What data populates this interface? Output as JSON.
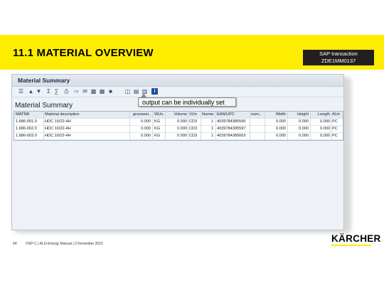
{
  "slide": {
    "title": "11.1 MATERIAL OVERVIEW",
    "sap_label": "SAP transaction",
    "sap_code": "ZDE1MM0137",
    "colors": {
      "banner": "#ffed00",
      "sap_box": "#231f20"
    }
  },
  "sap_window": {
    "title": "Material Summary",
    "section_title": "Material Summary",
    "toolbar_icons": [
      "details-icon",
      "select-icon",
      "filter-icon",
      "sum-icon",
      "subtotal-icon",
      "print-icon",
      "export-icon",
      "mail-icon",
      "graphic-icon",
      "save-icon",
      "abc-icon",
      "layout-icon",
      "choose-layout-icon",
      "save-layout-icon",
      "info-icon"
    ],
    "info_icon_glyph": "i",
    "table": {
      "columns": [
        "MATNR",
        "Material description",
        "grosswei..",
        "WUn",
        "Volume",
        "VUn",
        "Numer",
        "EAN/UPC",
        "num..",
        "Width",
        "Height",
        "Length",
        "AUn"
      ],
      "rows": [
        [
          "1.686-001.0",
          "HDC 10/22-4H",
          "0.000",
          "KG",
          "0.000",
          "CD3",
          "1",
          "4039784385590",
          "",
          "0.000",
          "0.000",
          "0.000",
          "PC"
        ],
        [
          "1.686-002.0",
          "HDC 10/22-4H",
          "0.000",
          "KG",
          "0.000",
          "CD3",
          "1",
          "4039784395597",
          "",
          "0.000",
          "0.000",
          "0.000",
          "PC"
        ],
        [
          "1.686-003.0",
          "HDC 10/22-4H",
          "0.000",
          "KG",
          "0.000",
          "CD3",
          "1",
          "4039784385603",
          "",
          "0.000",
          "0.000",
          "0.000",
          "PC"
        ]
      ]
    }
  },
  "callout": {
    "text": "output can be individually set"
  },
  "footer": {
    "page": "64",
    "doc": "OSP-C | ALG-Energy Manual | 3 November 2015"
  },
  "logo": {
    "text": "KÄRCHER"
  }
}
